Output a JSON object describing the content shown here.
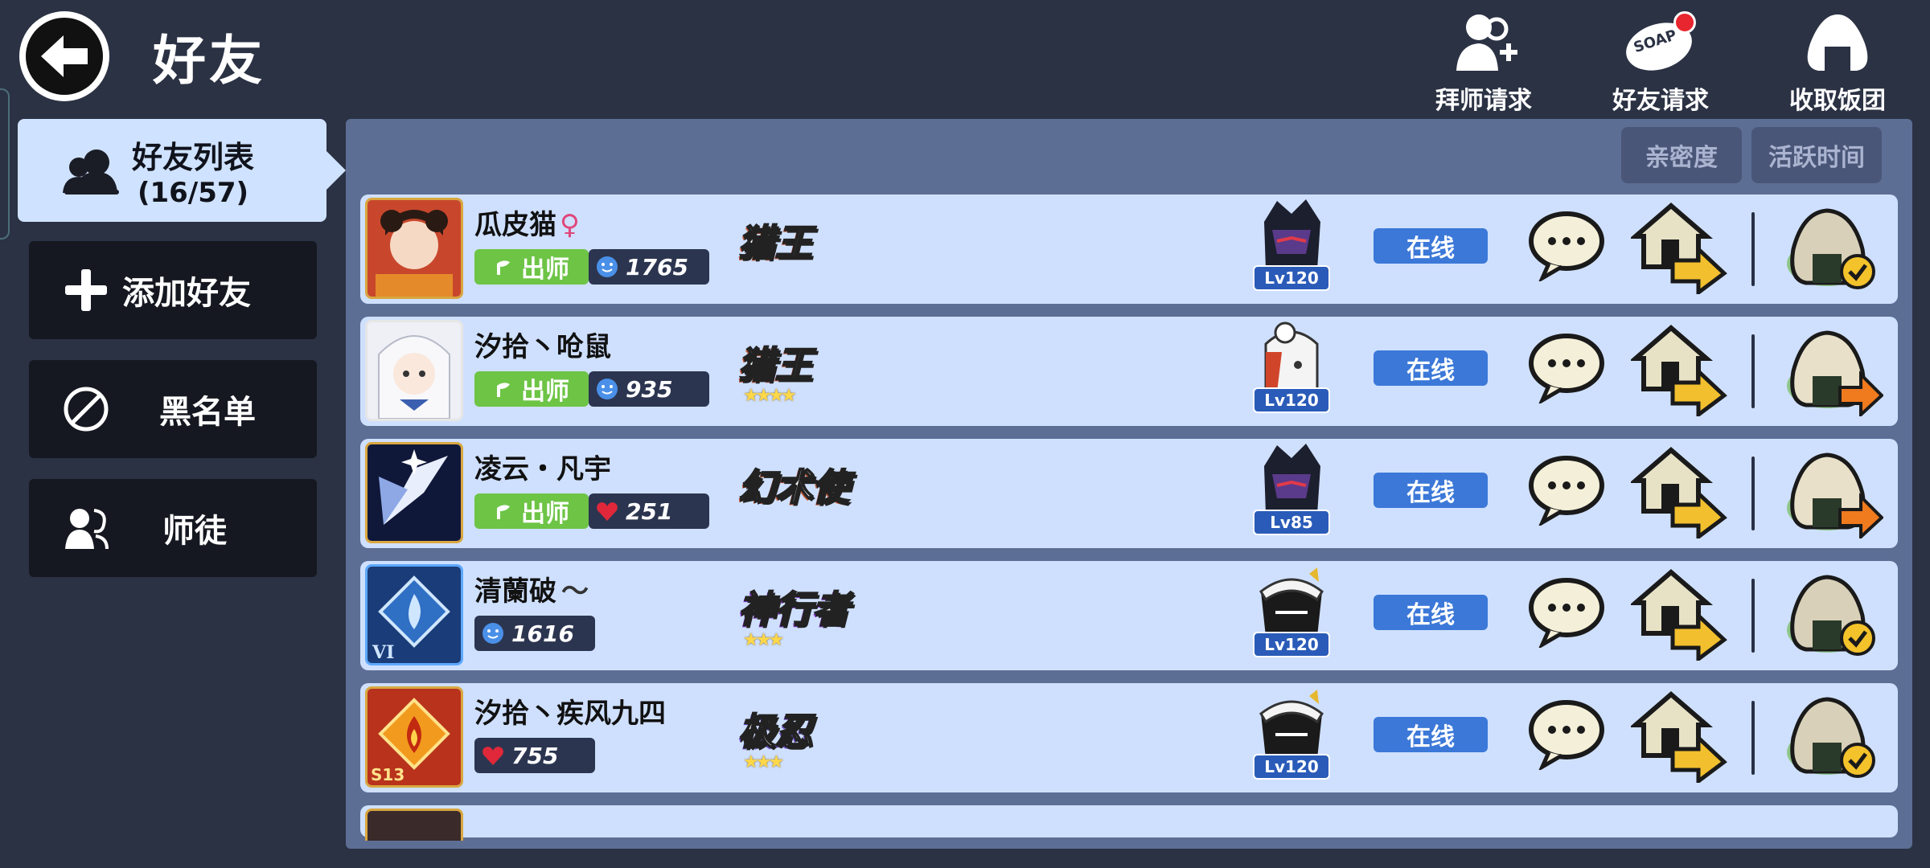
{
  "header": {
    "title": "好友",
    "actions": [
      {
        "id": "apprentice",
        "label": "拜师请求",
        "icon": "add-mentor-icon",
        "badge": false
      },
      {
        "id": "friend-requests",
        "label": "好友请求",
        "icon": "soap-bubble-icon",
        "badge": true
      },
      {
        "id": "collect",
        "label": "收取饭团",
        "icon": "rice-ball-icon",
        "badge": false
      }
    ]
  },
  "sidebar": {
    "active": {
      "label": "好友列表",
      "count": "(16/57)"
    },
    "items": [
      {
        "label": "添加好友",
        "icon": "plus-icon"
      },
      {
        "label": "黑名单",
        "icon": "block-icon"
      },
      {
        "label": "师徒",
        "icon": "mentor-icon"
      }
    ]
  },
  "sort": {
    "intimacy": "亲密度",
    "active_time": "活跃时间"
  },
  "friends": [
    {
      "name": "瓜皮猫",
      "gender": "♀",
      "master_tag": "出师",
      "stat_type": "smile",
      "stat": "1765",
      "title": "猎王",
      "title_stars": "",
      "level": "Lv120",
      "status": "在线",
      "gift_state": "received"
    },
    {
      "name": "汐拾丶呛鼠",
      "gender": "",
      "master_tag": "出师",
      "stat_type": "smile",
      "stat": "935",
      "title": "猎王",
      "title_stars": "★★★★",
      "level": "Lv120",
      "status": "在线",
      "gift_state": "send"
    },
    {
      "name": "凌云・凡宇",
      "gender": "",
      "master_tag": "出师",
      "stat_type": "heart",
      "stat": "251",
      "title": "幻术使",
      "title_stars": "",
      "level": "Lv85",
      "status": "在线",
      "gift_state": "send"
    },
    {
      "name": "清蘭破",
      "gender": "",
      "master_tag": "",
      "stat_type": "smile",
      "stat": "1616",
      "title": "神行者",
      "title_stars": "★★★",
      "level": "Lv120",
      "status": "在线",
      "gift_state": "received"
    },
    {
      "name": "汐拾丶疾风九四",
      "gender": "",
      "master_tag": "",
      "stat_type": "heart",
      "stat": "755",
      "title": "极忍",
      "title_stars": "★★★",
      "level": "Lv120",
      "status": "在线",
      "gift_state": "received"
    }
  ],
  "colors": {
    "background": "#2b3244",
    "panel": "#5d6e95",
    "row": "#cfe0ff",
    "online": "#3b78d8",
    "master": "#6dc445"
  }
}
